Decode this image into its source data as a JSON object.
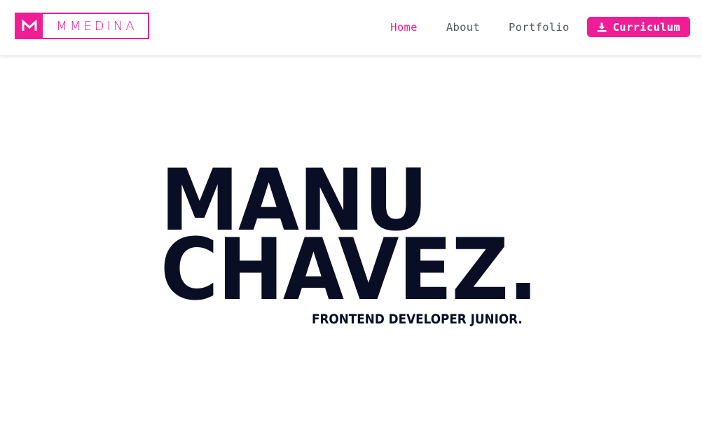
{
  "navbar": {
    "logo": {
      "monogram": "M",
      "wordmark": "MMEDINA",
      "icon": "m-monogram-icon"
    },
    "links": [
      {
        "label": "Home",
        "active": true
      },
      {
        "label": "About",
        "active": false
      },
      {
        "label": "Portfolio",
        "active": false
      }
    ],
    "cv_button": {
      "label": "Curriculum",
      "icon": "download-icon"
    }
  },
  "hero": {
    "name_line_1": "MANU",
    "name_line_2": "CHAVEZ.",
    "subtitle": "FRONTEND DEVELOPER JUNIOR."
  },
  "colors": {
    "accent": "#f01d96",
    "heading": "#0a0e24",
    "nav_text": "#555a60",
    "background": "#ffffff"
  }
}
